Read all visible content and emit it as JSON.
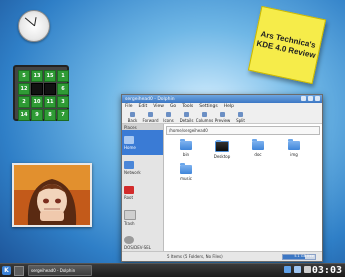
{
  "desktop": {
    "sticky_note": "Ars Technica's KDE 4.0 Review",
    "puzzle_tiles": [
      "5",
      "13",
      "15",
      "1",
      "12",
      "",
      "",
      "6",
      "2",
      "10",
      "11",
      "3",
      "14",
      "9",
      "8",
      "7"
    ]
  },
  "window": {
    "title": "sergeihead0 - Dolphin",
    "menu": [
      "File",
      "Edit",
      "View",
      "Go",
      "Tools",
      "Settings",
      "Help"
    ],
    "toolbar": [
      "Back",
      "Forward",
      "Icons",
      "Details",
      "Columns",
      "Preview",
      "Split"
    ],
    "location": "/home/sergeihead0",
    "places_header": "Places",
    "places": [
      "Home",
      "Network",
      "Root",
      "Trash",
      "DOS/DEV-SEL"
    ],
    "files": [
      "bin",
      "Desktop",
      "doc",
      "img",
      "music"
    ],
    "status": "5 Items (5 Folders, No Files)",
    "free_space": "5.1 GB free"
  },
  "taskbar": {
    "kmenu": "K",
    "task": "sergeihead0 - Dolphin",
    "clock": "03:03"
  },
  "colors": {
    "accent": "#3a7bd5",
    "sticky": "#f6ec4a",
    "tile": "#2f9b35"
  }
}
